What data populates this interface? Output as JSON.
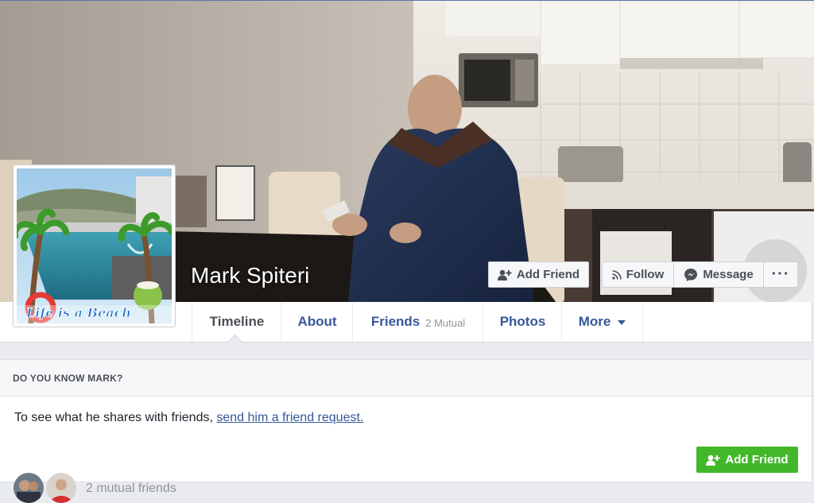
{
  "profile": {
    "name": "Mark Spiteri",
    "picture_caption": "Life is a Beach"
  },
  "cover_actions": {
    "add_friend": "Add Friend",
    "follow": "Follow",
    "message": "Message",
    "more": "···"
  },
  "tabs": [
    {
      "label": "Timeline",
      "active": true
    },
    {
      "label": "About"
    },
    {
      "label": "Friends",
      "badge": "2 Mutual"
    },
    {
      "label": "Photos"
    },
    {
      "label": "More"
    }
  ],
  "know_card": {
    "header": "DO YOU KNOW MARK?",
    "text": "To see what he shares with friends, ",
    "link": "send him a friend request.",
    "add_friend": "Add Friend",
    "mutual_friends": "2 mutual friends"
  },
  "colors": {
    "link_blue": "#365899",
    "green": "#42b72a",
    "gray_text": "#90949c"
  }
}
